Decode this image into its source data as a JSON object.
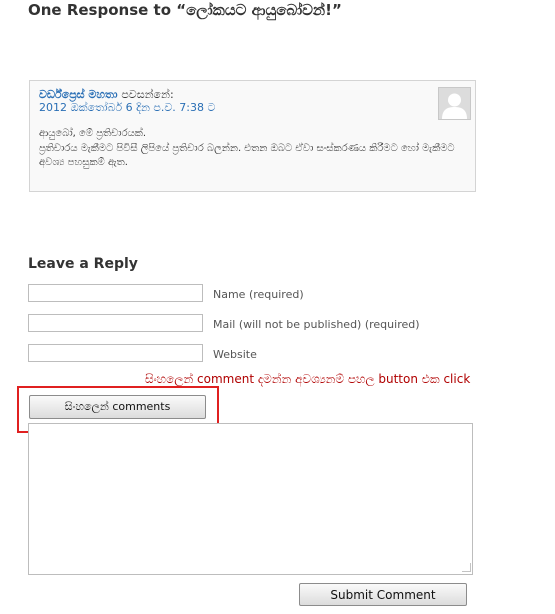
{
  "responses": {
    "heading": "One Response to “ලෝකයට ආයුබෝවන්!”"
  },
  "comment": {
    "author": "වර්ඩ්ප්‍රෙස් මහතා",
    "says": "පවසන්නේ:",
    "date": "2012 ඔක්තෝබර් 6 දින ප.ව. 7:38 ට",
    "avatar_icon": "default-avatar-icon",
    "lines": [
      "ආයුබෝ, මේ ප්‍රතිචාරයක්.",
      "ප්‍රතිචාරය මැකීමට පිවිසී ලිපියේ ප්‍රතිචාර බලන්න. එතන ඔබට ඒවා සංස්කරණය කිරීමට හෝ මැකීමට අවශ්‍ය පහසුකම් ඇත."
    ]
  },
  "reply": {
    "title": "Leave a Reply",
    "name_label": "Name (required)",
    "mail_label": "Mail (will not be published) (required)",
    "website_label": "Website",
    "sinhala_hint": "සිංහලෙන් comment දමන්න අවශ්‍යනම් පහල button එක click",
    "sinhala_button": "සිංහලෙන් comments",
    "submit_button": "Submit Comment"
  },
  "colors": {
    "link": "#2a6fb5",
    "hint": "#b00000",
    "highlight": "#e02020"
  }
}
